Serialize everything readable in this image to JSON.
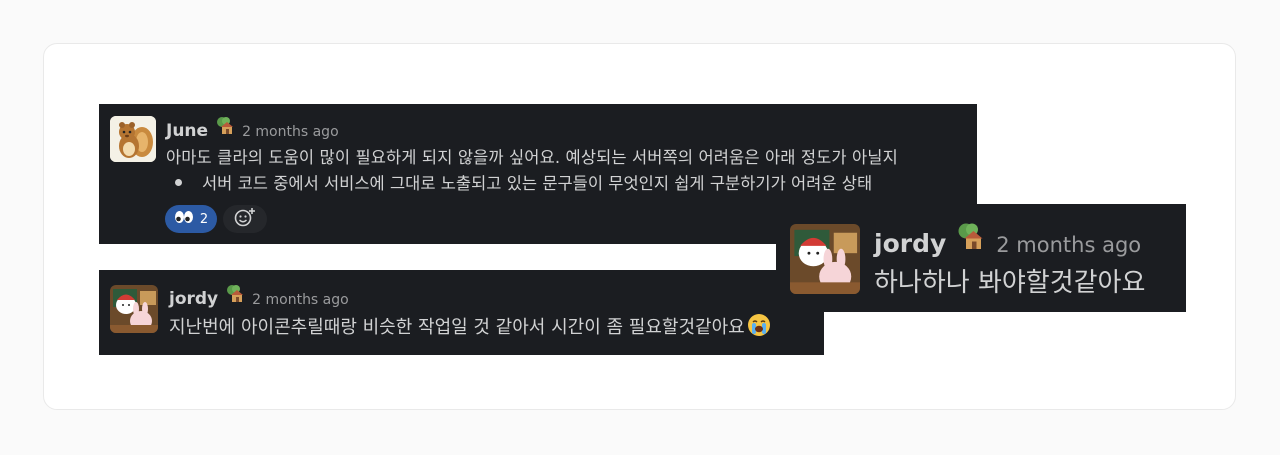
{
  "messages": [
    {
      "author": "June",
      "author_status_icon": "tree-house-emoji",
      "timestamp": "2 months ago",
      "text": "아마도 클라의 도움이 많이 필요하게 되지 않을까 싶어요. 예상되는 서버쪽의 어려움은 아래 정도가 아닐지",
      "bullets": [
        "서버 코드 중에서 서비스에 그대로 노출되고 있는 문구들이 무엇인지 쉽게 구분하기가 어려운 상태"
      ],
      "reaction": {
        "icon": "eyes-emoji",
        "count": "2"
      },
      "add_reaction_icon": "add-reaction-icon"
    },
    {
      "author": "jordy",
      "author_status_icon": "tree-house-emoji",
      "timestamp": "2 months ago",
      "text": "지난번에 아이콘추릴때랑 비슷한 작업일 것 같아서 시간이 좀 필요할것같아요",
      "trailing_emoji": "crying-face-emoji"
    },
    {
      "author": "jordy",
      "author_status_icon": "tree-house-emoji",
      "timestamp": "2 months ago",
      "text": "하나하나 봐야할것같아요"
    }
  ],
  "colors": {
    "message_background": "#1b1d21",
    "text": "#d1d2d3",
    "timestamp": "#9a9b9d",
    "reaction_active": "#2c5aa4",
    "card_background": "#ffffff"
  }
}
